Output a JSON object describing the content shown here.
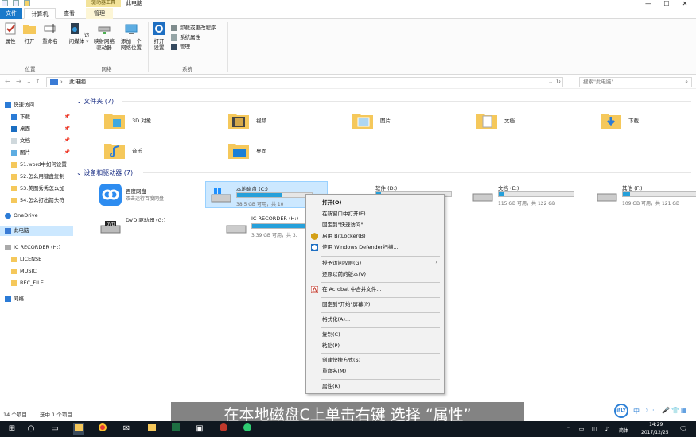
{
  "titlebar": {
    "contextual_tab": "驱动器工具",
    "title": "此电脑",
    "minimize": "—",
    "maximize": "☐",
    "close": "✕"
  },
  "tabs": [
    {
      "label": "文件"
    },
    {
      "label": "计算机"
    },
    {
      "label": "查看"
    },
    {
      "label": "管理"
    }
  ],
  "ribbon": {
    "properties": "属性",
    "open": "打开",
    "rename": "重命名",
    "location_group": "位置",
    "access_media_1": "访问媒体",
    "map_drive_1": "映射网络",
    "map_drive_2": "驱动器",
    "add_location_1": "添加一个",
    "add_location_2": "网络位置",
    "network_group": "网络",
    "open_settings_1": "打开",
    "open_settings_2": "设置",
    "uninstall": "卸载或更改程序",
    "system_props": "系统属性",
    "manage": "管理",
    "system_group": "系统"
  },
  "addressbar": {
    "path": "此电脑",
    "search_placeholder": "搜索\"此电脑\""
  },
  "navpane": {
    "quick_access": "快速访问",
    "downloads": "下载",
    "desktop": "桌面",
    "documents": "文档",
    "pictures": "图片",
    "recent1": "51.word中如何设置",
    "recent2": "52.怎么用键盘复制",
    "recent3": "53.美图秀秀怎么加",
    "recent4": "54.怎么打出箭头符",
    "onedrive": "OneDrive",
    "thispc": "此电脑",
    "icrecorder": "IC RECORDER (H:)",
    "license": "LICENSE",
    "music": "MUSIC",
    "rec_file": "REC_FILE",
    "network": "网络"
  },
  "folders": {
    "header": "文件夹 (7)",
    "items": [
      {
        "label": "3D 对象"
      },
      {
        "label": "视频"
      },
      {
        "label": "图片"
      },
      {
        "label": "文档"
      },
      {
        "label": "下载"
      },
      {
        "label": "音乐"
      },
      {
        "label": "桌面"
      }
    ]
  },
  "devices": {
    "header": "设备和驱动器 (7)",
    "baidu": {
      "name": "百度网盘",
      "sub": "双击运行百度网盘"
    },
    "c": {
      "name": "本地磁盘 (C:)",
      "size": "38.5 GB 可用，共 10",
      "used": 0.6
    },
    "d": {
      "name": "软件 (D:)",
      "used": 0.06
    },
    "e": {
      "name": "文档 (E:)",
      "size": "115 GB 可用，共 122 GB",
      "used": 0.06
    },
    "f": {
      "name": "其他 (F:)",
      "size": "109 GB 可用，共 121 GB",
      "used": 0.1
    },
    "dvd": {
      "name": "DVD 驱动器 (G:)",
      "badge": "DVD"
    },
    "h": {
      "name": "IC RECORDER (H:)",
      "size": "3.39 GB 可用，共 3.",
      "used": 0.7
    }
  },
  "contextmenu": {
    "open": "打开(O)",
    "open_new_window": "在新窗口中打开(E)",
    "pin_quick": "固定到\"快速访问\"",
    "bitlocker": "启用 BitLocker(B)",
    "defender": "使用 Windows Defender扫描...",
    "grant_access": "授予访问权限(G)",
    "restore": "还原以前的版本(V)",
    "acrobat": "在 Acrobat 中合并文件...",
    "pin_start": "固定到\"开始\"屏幕(P)",
    "format": "格式化(A)...",
    "copy": "复制(C)",
    "paste": "粘贴(P)",
    "shortcut": "创建快捷方式(S)",
    "rename": "重命名(M)",
    "properties": "属性(R)"
  },
  "statusbar": {
    "count": "14 个项目",
    "selected": "选中 1 个项目"
  },
  "subtitle": "在本地磁盘C上单击右键 选择 “属性”",
  "taskbar": {
    "time": "14:29",
    "date": "2017/12/25",
    "ime": "简体",
    "ifly": "iFLY",
    "ifly_lang": "中"
  }
}
